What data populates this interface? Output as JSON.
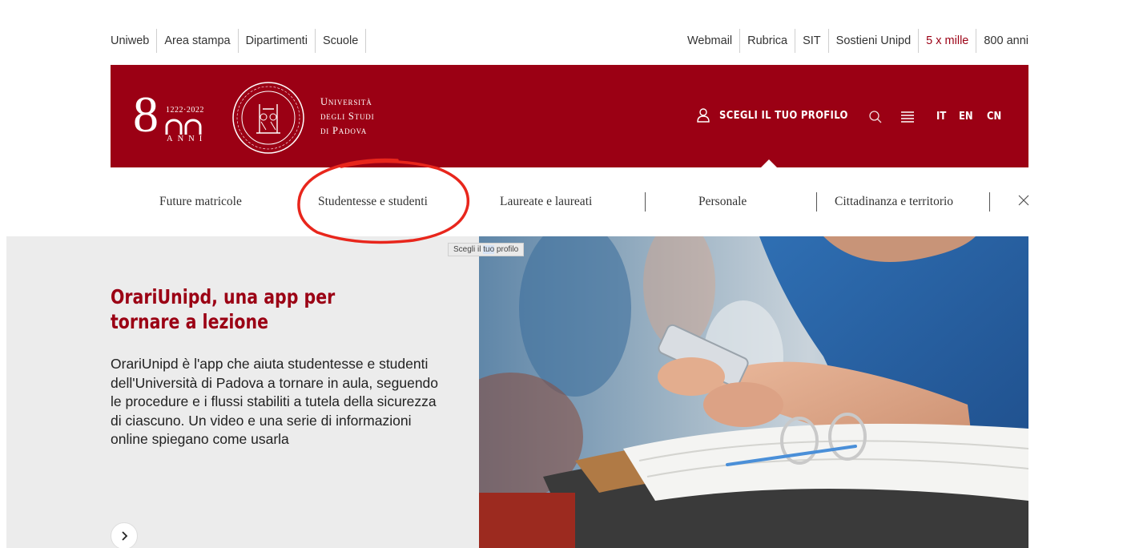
{
  "topbar": {
    "left_links": [
      "Uniweb",
      "Area stampa",
      "Dipartimenti",
      "Scuole"
    ],
    "right_links": [
      "Webmail",
      "Rubrica",
      "SIT",
      "Sostieni Unipd",
      "5 x mille",
      "800 anni"
    ]
  },
  "header": {
    "logo_years": "1222·2022",
    "logo_number": "8",
    "logo_anni": "ANNI",
    "university_name": [
      "Università",
      "degli Studi",
      "di Padova"
    ],
    "profile_label": "SCEGLI IL TUO PROFILO",
    "languages": [
      "IT",
      "EN",
      "CN"
    ]
  },
  "profile_nav": {
    "items": [
      "Future matricole",
      "Studentesse e studenti",
      "Laureate e laureati",
      "Personale",
      "Cittadinanza e territorio"
    ]
  },
  "tooltip": {
    "before": "Scegli il ",
    "highlighted": "tuo",
    "after": " profilo"
  },
  "hero": {
    "title": "OrariUnipd, una app per tornare a lezione",
    "text": "OrariUnipd è l'app che aiuta studentesse e studenti dell'Università di Padova a tornare in aula, seguendo le procedure e i flussi stabiliti a tutela della sicurezza di ciascuno. Un video e una serie di informazioni online spiegano come usarla"
  },
  "colors": {
    "brand_red": "#9b0014",
    "annotation_red": "#e8261c",
    "hero_bg": "#ececec"
  },
  "icons": {
    "profile": "person-outline-icon",
    "search": "search-icon",
    "menu": "hamburger-menu-icon",
    "close": "close-icon",
    "next": "chevron-right-icon"
  }
}
